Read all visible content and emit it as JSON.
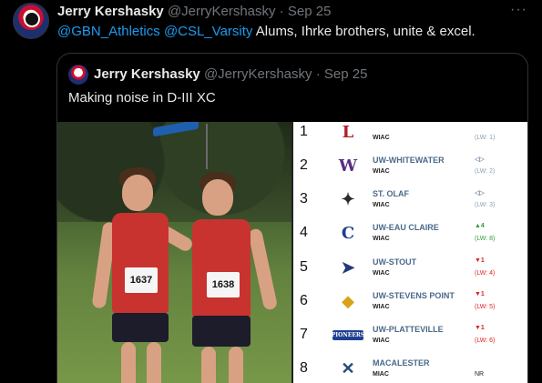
{
  "tweet": {
    "author_name": "Jerry Kershasky",
    "author_handle": "@JerryKershasky",
    "date": "· Sep 25",
    "more_label": "···",
    "mention_1": "@GBN_Athletics",
    "mention_2": "@CSL_Varsity",
    "text": " Alums, Ihrke brothers, unite & excel."
  },
  "quote": {
    "author_name": "Jerry Kershasky",
    "author_handle": "@JerryKershasky",
    "date": "· Sep 25",
    "text": "Making noise in D-III XC"
  },
  "photo": {
    "bib_left": "1637",
    "bib_right": "1638"
  },
  "rankings": [
    {
      "rank": "1",
      "school": "",
      "conf": "WIAC",
      "change": "",
      "prev": "(LW: 1)",
      "logo_color": "#b0202b",
      "logo_glyph": "L",
      "change_type": "same"
    },
    {
      "rank": "2",
      "school": "UW-WHITEWATER",
      "conf": "WIAC",
      "change": "◁▷",
      "prev": "(LW: 2)",
      "logo_color": "#5a2d82",
      "logo_glyph": "W",
      "change_type": "same"
    },
    {
      "rank": "3",
      "school": "ST. OLAF",
      "conf": "WIAC",
      "change": "◁▷",
      "prev": "(LW: 3)",
      "logo_color": "#2a2a2a",
      "logo_glyph": "✦",
      "change_type": "same"
    },
    {
      "rank": "4",
      "school": "UW-EAU CLAIRE",
      "conf": "WIAC",
      "change": "▲4",
      "prev": "(LW: 8)",
      "logo_color": "#1f3f8f",
      "logo_glyph": "C",
      "change_type": "up"
    },
    {
      "rank": "5",
      "school": "UW-STOUT",
      "conf": "WIAC",
      "change": "▼1",
      "prev": "(LW: 4)",
      "logo_color": "#243a78",
      "logo_glyph": "➤",
      "change_type": "down"
    },
    {
      "rank": "6",
      "school": "UW-STEVENS POINT",
      "conf": "WIAC",
      "change": "▼1",
      "prev": "(LW: 5)",
      "logo_color": "#d8a31a",
      "logo_glyph": "◆",
      "change_type": "down"
    },
    {
      "rank": "7",
      "school": "UW-PLATTEVILLE",
      "conf": "WIAC",
      "change": "▼1",
      "prev": "(LW: 6)",
      "logo_color": "#1f3f8f",
      "logo_glyph": "PIONEERS",
      "change_type": "down"
    },
    {
      "rank": "8",
      "school": "MACALESTER",
      "conf": "MIAC",
      "change": "",
      "prev": "NR",
      "logo_color": "#2a4a7a",
      "logo_glyph": "✕",
      "change_type": "nr"
    }
  ],
  "colors": {
    "background": "#000000",
    "mention": "#1d9bf0",
    "muted": "#71767b"
  }
}
